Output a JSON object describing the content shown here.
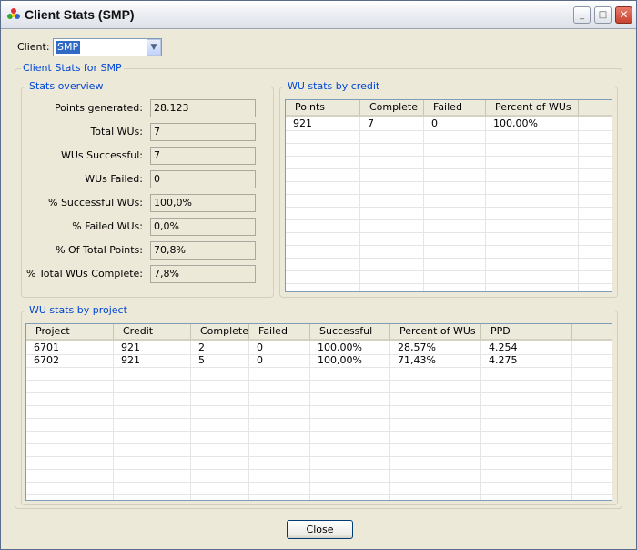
{
  "window": {
    "title": "Client Stats (SMP)"
  },
  "client": {
    "label": "Client:",
    "selected": "SMP"
  },
  "group_main": {
    "title": "Client Stats for SMP"
  },
  "overview": {
    "title": "Stats overview",
    "rows": [
      {
        "label": "Points generated:",
        "value": "28.123"
      },
      {
        "label": "Total WUs:",
        "value": "7"
      },
      {
        "label": "WUs Successful:",
        "value": "7"
      },
      {
        "label": "WUs Failed:",
        "value": "0"
      },
      {
        "label": "% Successful WUs:",
        "value": "100,0%"
      },
      {
        "label": "% Failed WUs:",
        "value": "0,0%"
      },
      {
        "label": "% Of Total Points:",
        "value": "70,8%"
      },
      {
        "label": "% Total WUs Complete:",
        "value": "7,8%"
      }
    ]
  },
  "credit_table": {
    "title": "WU stats by credit",
    "columns": [
      "Points",
      "Complete",
      "Failed",
      "Percent of WUs"
    ],
    "rows": [
      [
        "921",
        "7",
        "0",
        "100,00%"
      ]
    ]
  },
  "project_table": {
    "title": "WU stats by project",
    "columns": [
      "Project",
      "Credit",
      "Complete",
      "Failed",
      "Successful",
      "Percent of WUs",
      "PPD"
    ],
    "rows": [
      [
        "6701",
        "921",
        "2",
        "0",
        "100,00%",
        "28,57%",
        "4.254"
      ],
      [
        "6702",
        "921",
        "5",
        "0",
        "100,00%",
        "71,43%",
        "4.275"
      ]
    ]
  },
  "buttons": {
    "close": "Close"
  },
  "icons": {
    "app": "app-icon",
    "minimize": "minimize-icon",
    "maximize": "maximize-icon",
    "close": "close-icon",
    "dropdown": "chevron-down-icon"
  }
}
